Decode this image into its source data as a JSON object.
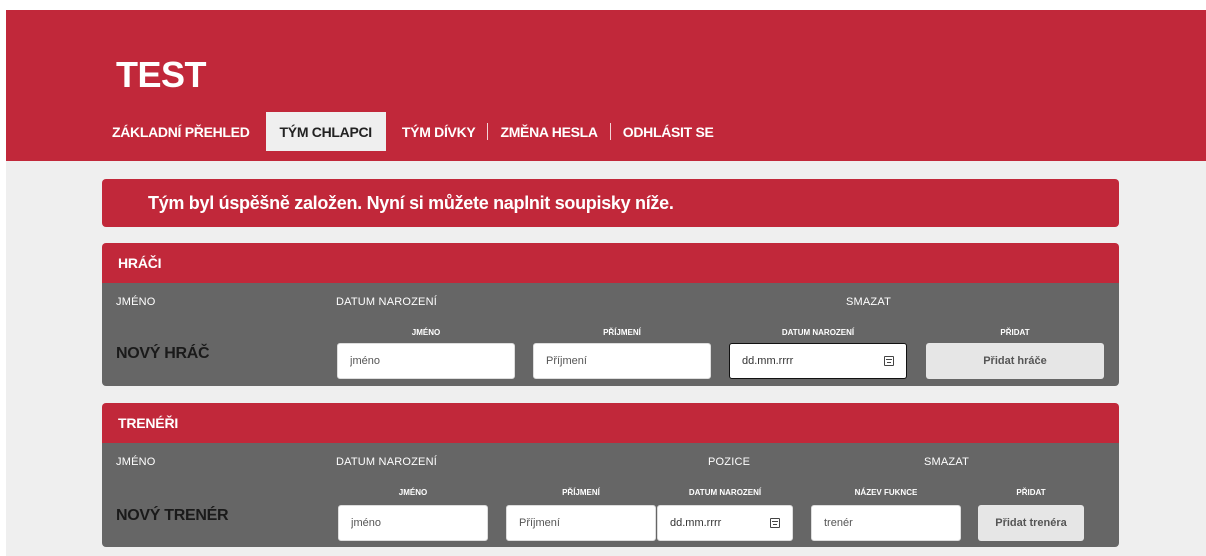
{
  "site": {
    "title": "TEST"
  },
  "nav": {
    "items": [
      {
        "label": "ZÁKLADNÍ PŘEHLED"
      },
      {
        "label": "TÝM CHLAPCI"
      },
      {
        "label": "TÝM DÍVKY"
      },
      {
        "label": "ZMĚNA HESLA"
      },
      {
        "label": "ODHLÁSIT SE"
      }
    ],
    "active": "TÝM CHLAPCI"
  },
  "alert": {
    "message": "Tým byl úspěšně založen. Nyní si můžete naplnit soupisky níže."
  },
  "players": {
    "title": "HRÁČI",
    "columns": [
      "JMÉNO",
      "DATUM NAROZENÍ",
      "SMAZAT"
    ],
    "new_label": "NOVÝ HRÁČ",
    "field_labels": {
      "first": "JMÉNO",
      "last": "PŘÍJMENÍ",
      "dob": "DATUM NAROZENÍ",
      "add": "PŘIDAT"
    },
    "placeholders": {
      "first": "jméno",
      "last": "Příjmení"
    },
    "dob_value": "dd.mm.rrrr",
    "add_button": "Přidat hráče"
  },
  "coaches": {
    "title": "TRENÉŘI",
    "columns": [
      "JMÉNO",
      "DATUM NAROZENÍ",
      "POZICE",
      "SMAZAT"
    ],
    "new_label": "NOVÝ TRENÉR",
    "field_labels": {
      "first": "JMÉNO",
      "last": "PŘÍJMENÍ",
      "dob": "DATUM NAROZENÍ",
      "role": "NÁZEV FUKNCE",
      "add": "PŘIDAT"
    },
    "placeholders": {
      "first": "jméno",
      "last": "Příjmení",
      "role": "trenér"
    },
    "dob_value": "dd.mm.rrrr",
    "add_button": "Přidat trenéra"
  },
  "colors": {
    "brand": "#c1283a",
    "panel": "#666666",
    "background": "#efefef"
  }
}
